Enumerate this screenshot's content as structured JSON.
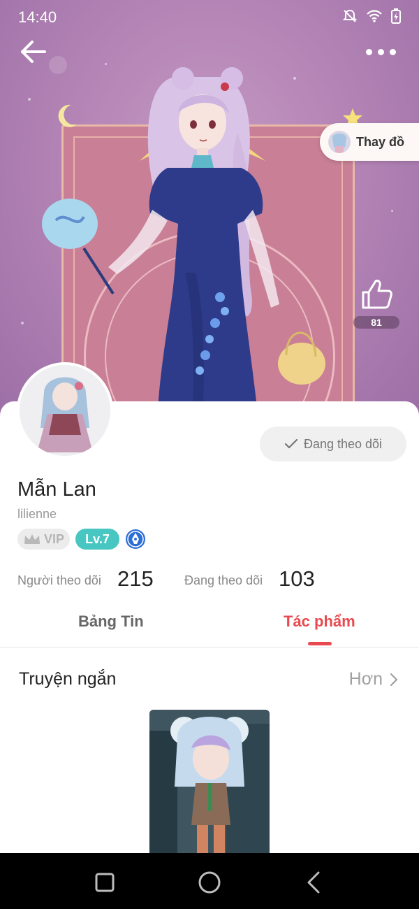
{
  "status_bar": {
    "time": "14:40",
    "icons": [
      "notifications-off-icon",
      "wifi-icon",
      "battery-charging-icon"
    ]
  },
  "hero": {
    "change_outfit_label": "Thay đồ",
    "like_count": "81"
  },
  "profile": {
    "name": "Mẫn Lan",
    "username": "lilienne",
    "follow_button_label": "Đang theo dõi",
    "vip_label": "VIP",
    "level_label": "Lv.7",
    "followers_label": "Người theo dõi",
    "followers_count": "215",
    "following_label": "Đang theo dõi",
    "following_count": "103"
  },
  "tabs": {
    "feed": "Bảng Tin",
    "works": "Tác phẩm",
    "active": "works"
  },
  "section": {
    "title": "Truyện ngắn",
    "more_label": "Hơn"
  },
  "colors": {
    "accent": "#e84a4f",
    "level_badge": "#48c6c2",
    "hero_bg": "#b585b6"
  }
}
